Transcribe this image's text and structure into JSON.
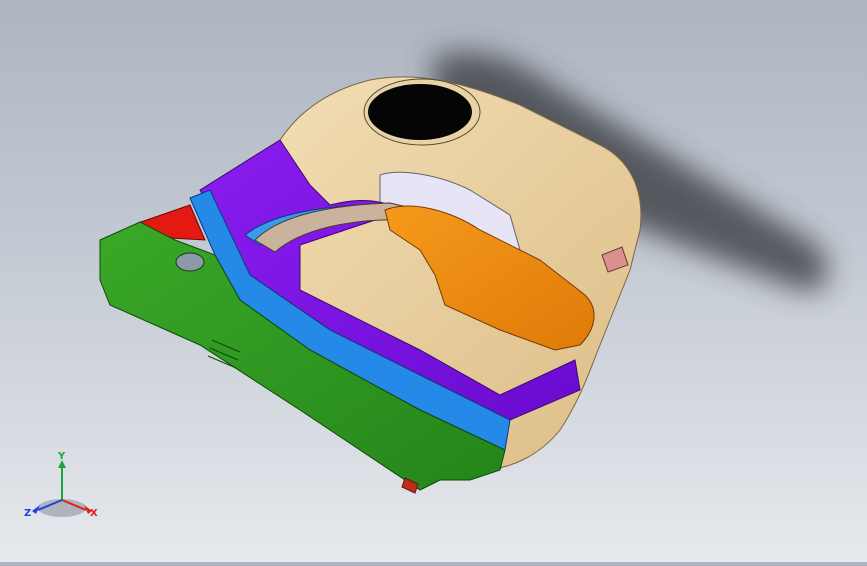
{
  "viewport": {
    "model_name": "",
    "colors": {
      "beige": "#e9cf9e",
      "purple": "#7f12e8",
      "blue": "#2589e8",
      "green": "#2e9e1c",
      "orange": "#f08a0c",
      "red": "#e41a12",
      "shadow": "#3a3d42"
    }
  },
  "triad": {
    "x_label": "X",
    "y_label": "Y",
    "z_label": "Z",
    "x_color": "#e0201a",
    "y_color": "#1aa53a",
    "z_color": "#1f3fe0"
  }
}
